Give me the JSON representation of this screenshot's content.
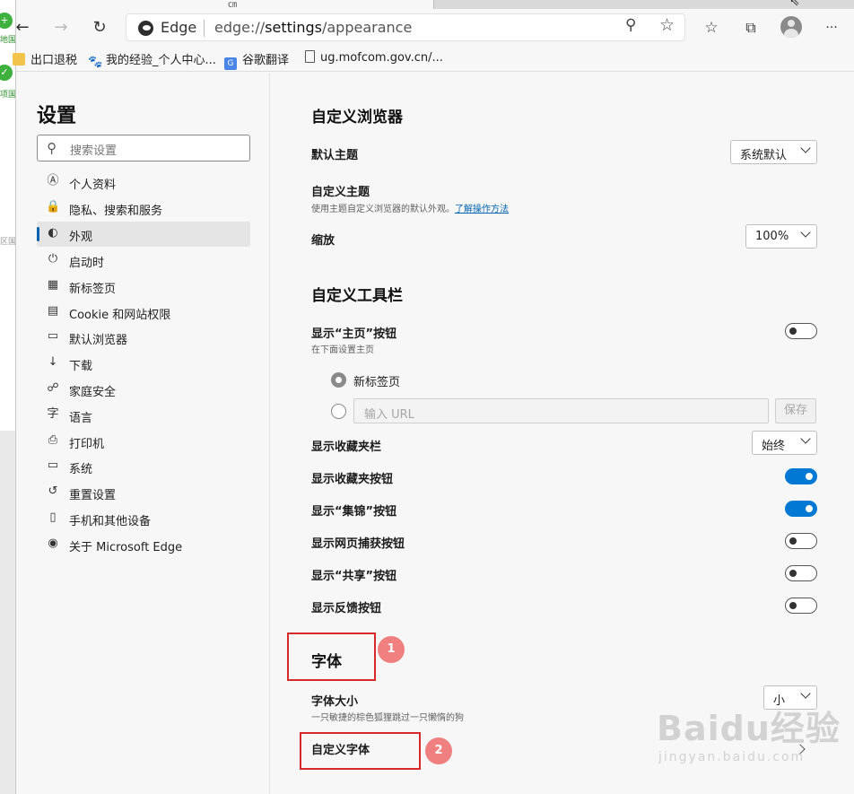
{
  "topbar": {
    "tab_mark": "㎝"
  },
  "left_strip": {
    "item1": "地国",
    "item2": "项国",
    "item3": "区国"
  },
  "toolbar": {
    "back_icon": "arrow-left-icon",
    "forward_icon": "arrow-right-icon",
    "refresh_icon": "refresh-icon",
    "brand": "Edge",
    "url_scheme": "edge://",
    "url_path": "settings",
    "url_rest": "/appearance",
    "more_label": "···"
  },
  "bookmarks": [
    {
      "label": "出口退税"
    },
    {
      "label": "我的经验_个人中心..."
    },
    {
      "label": "谷歌翻译"
    },
    {
      "label": "ug.mofcom.gov.cn/..."
    }
  ],
  "sidebar": {
    "title": "设置",
    "search_placeholder": "搜索设置",
    "items": [
      {
        "label": "个人资料",
        "icon": "profile-icon",
        "glyph": "Ⓐ"
      },
      {
        "label": "隐私、搜索和服务",
        "icon": "lock-icon",
        "glyph": "🔒"
      },
      {
        "label": "外观",
        "icon": "palette-icon",
        "glyph": "◐"
      },
      {
        "label": "启动时",
        "icon": "power-icon",
        "glyph": "⏻"
      },
      {
        "label": "新标签页",
        "icon": "new-tab-icon",
        "glyph": "▦"
      },
      {
        "label": "Cookie 和网站权限",
        "icon": "site-permissions-icon",
        "glyph": "▤"
      },
      {
        "label": "默认浏览器",
        "icon": "browser-icon",
        "glyph": "▭"
      },
      {
        "label": "下载",
        "icon": "download-icon",
        "glyph": "↓"
      },
      {
        "label": "家庭安全",
        "icon": "family-icon",
        "glyph": "☍"
      },
      {
        "label": "语言",
        "icon": "language-icon",
        "glyph": "字"
      },
      {
        "label": "打印机",
        "icon": "printer-icon",
        "glyph": "⎙"
      },
      {
        "label": "系统",
        "icon": "system-icon",
        "glyph": "▭"
      },
      {
        "label": "重置设置",
        "icon": "reset-icon",
        "glyph": "↺"
      },
      {
        "label": "手机和其他设备",
        "icon": "phone-icon",
        "glyph": "▯"
      },
      {
        "label": "关于 Microsoft Edge",
        "icon": "edge-logo-icon",
        "glyph": "◉"
      }
    ],
    "active_index": 2
  },
  "main": {
    "customize_browser": {
      "heading": "自定义浏览器",
      "default_theme_label": "默认主题",
      "default_theme_value": "系统默认",
      "custom_theme_label": "自定义主题",
      "custom_theme_desc": "使用主题自定义浏览器的默认外观。",
      "custom_theme_link": "了解操作方法",
      "zoom_label": "缩放",
      "zoom_value": "100%"
    },
    "customize_toolbar": {
      "heading": "自定义工具栏",
      "home_button_label": "显示“主页”按钮",
      "home_button_desc": "在下面设置主页",
      "home_button_on": false,
      "radio_new_tab": "新标签页",
      "url_placeholder": "输入 URL",
      "save_label": "保存",
      "favorites_bar_label": "显示收藏夹栏",
      "favorites_bar_value": "始终",
      "favorites_button_label": "显示收藏夹按钮",
      "favorites_button_on": true,
      "collections_button_label": "显示“集锦”按钮",
      "collections_button_on": true,
      "web_capture_label": "显示网页捕获按钮",
      "web_capture_on": false,
      "share_button_label": "显示“共享”按钮",
      "share_button_on": false,
      "feedback_button_label": "显示反馈按钮",
      "feedback_button_on": false
    },
    "fonts": {
      "heading": "字体",
      "font_size_label": "字体大小",
      "font_size_desc": "一只敏捷的棕色狐狸跳过一只懒惰的狗",
      "font_size_value": "小",
      "custom_fonts_label": "自定义字体"
    },
    "annotations": {
      "badge1": "1",
      "badge2": "2",
      "annotation_color": "#d62a2a"
    }
  },
  "watermark": {
    "line1": "Baidu经验",
    "line2": "jingyan.baidu.com"
  },
  "colors": {
    "accent": "#0078d4",
    "link": "#0063b1"
  }
}
